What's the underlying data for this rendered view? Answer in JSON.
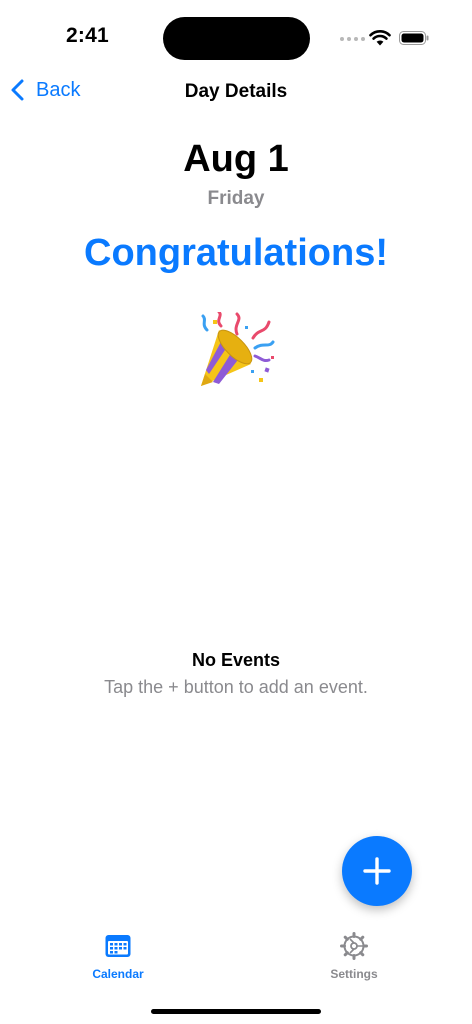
{
  "status_bar": {
    "time": "2:41"
  },
  "nav": {
    "back_label": "Back",
    "title": "Day Details"
  },
  "day": {
    "date": "Aug 1",
    "weekday": "Friday"
  },
  "message": {
    "headline": "Congratulations!"
  },
  "empty_state": {
    "title": "No Events",
    "subtitle": "Tap the + button to add an event."
  },
  "tabs": [
    {
      "label": "Calendar",
      "icon": "calendar-icon",
      "selected": true
    },
    {
      "label": "Settings",
      "icon": "gear-icon",
      "selected": false
    }
  ],
  "colors": {
    "accent": "#0a7aff",
    "secondary_text": "#8a8a8e"
  }
}
